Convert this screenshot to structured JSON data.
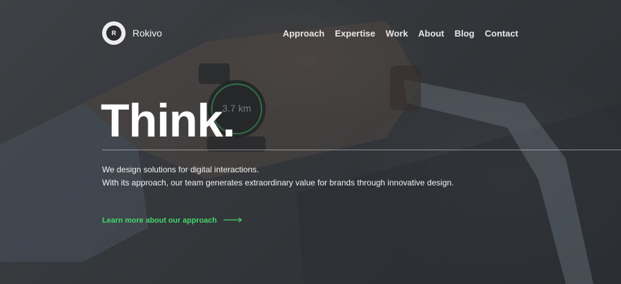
{
  "brand": {
    "logo_letter": "R",
    "name": "Rokivo"
  },
  "nav": {
    "items": [
      {
        "label": "Approach"
      },
      {
        "label": "Expertise"
      },
      {
        "label": "Work"
      },
      {
        "label": "About"
      },
      {
        "label": "Blog"
      },
      {
        "label": "Contact"
      }
    ]
  },
  "hero": {
    "headline": "Think.",
    "lines": [
      "We design solutions for digital interactions.",
      "With its approach, our team generates extraordinary value for brands through innovative design."
    ],
    "cta_label": "Learn more about our approach",
    "watch_display": "3.7 km"
  },
  "colors": {
    "accent": "#43d66b",
    "text": "#ffffff",
    "overlay": "#3b3e42"
  },
  "icons": {
    "cta_arrow": "long-arrow-right-icon"
  }
}
